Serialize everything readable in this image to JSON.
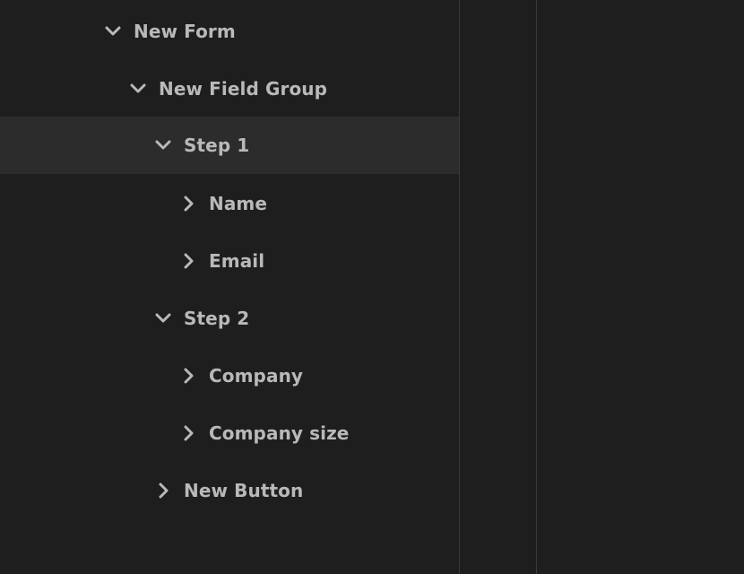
{
  "tree": {
    "rows": [
      {
        "label": "New Form",
        "expanded": true,
        "icon": "chevron-down-icon"
      },
      {
        "label": "New Field Group",
        "expanded": true,
        "icon": "chevron-down-icon"
      },
      {
        "label": "Step 1",
        "expanded": true,
        "selected": true,
        "icon": "chevron-down-icon"
      },
      {
        "label": "Name",
        "expanded": false,
        "icon": "chevron-right-icon"
      },
      {
        "label": "Email",
        "expanded": false,
        "icon": "chevron-right-icon"
      },
      {
        "label": "Step 2",
        "expanded": true,
        "icon": "chevron-down-icon"
      },
      {
        "label": "Company",
        "expanded": false,
        "icon": "chevron-right-icon"
      },
      {
        "label": "Company size",
        "expanded": false,
        "icon": "chevron-right-icon"
      },
      {
        "label": "New Button",
        "expanded": false,
        "icon": "chevron-right-icon"
      }
    ]
  },
  "colors": {
    "background": "#1e1e1e",
    "selected_row": "#2c2c2c",
    "text": "#b9b9b9",
    "divider": "#3a3a3a"
  }
}
